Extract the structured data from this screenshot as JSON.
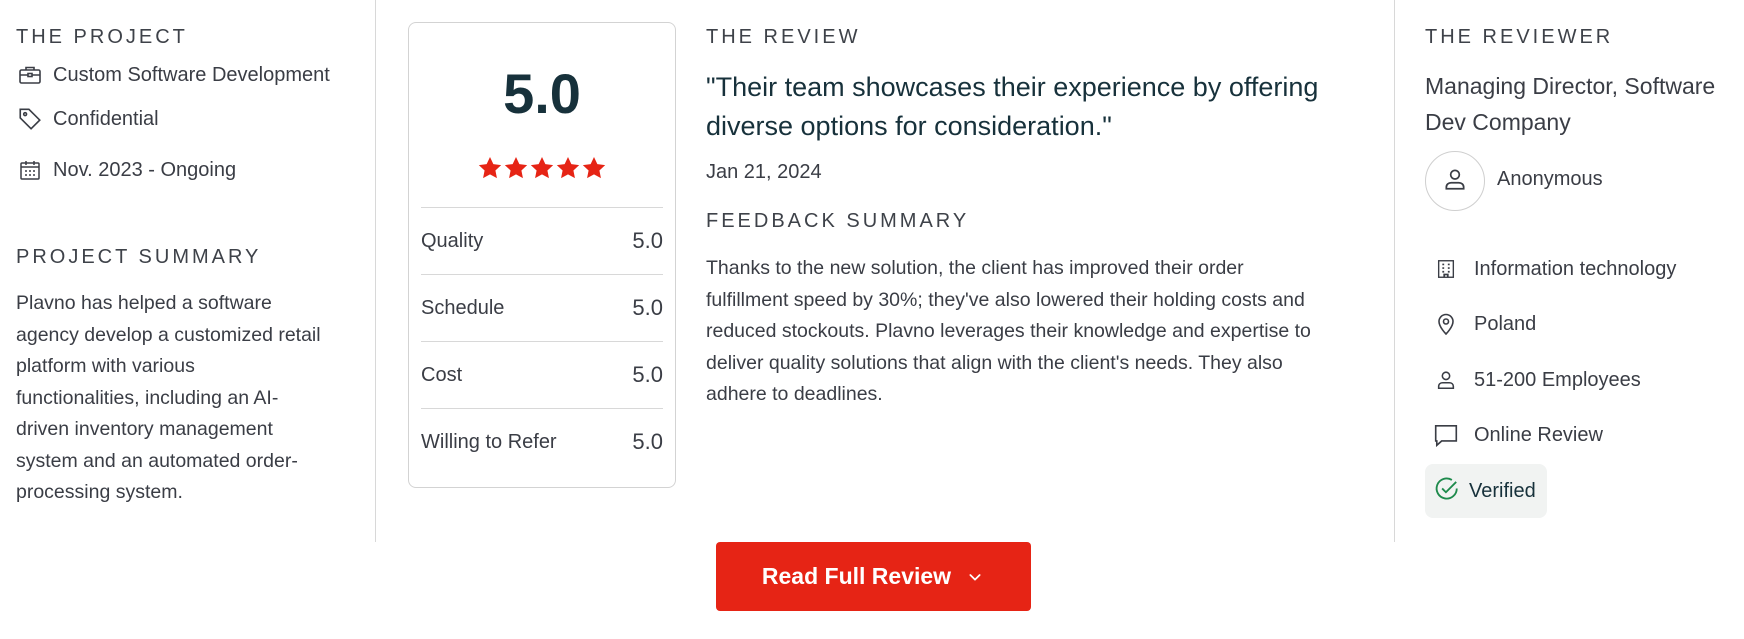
{
  "project": {
    "heading": "THE PROJECT",
    "service": "Custom Software Development",
    "budget": "Confidential",
    "dates": "Nov. 2023 - Ongoing",
    "summary_heading": "PROJECT SUMMARY",
    "summary_lines": [
      "Plavno has helped a software",
      "agency develop a customized retail",
      "platform with various",
      "functionalities, including an AI-",
      "driven inventory management",
      "system and an automated order-",
      "processing system."
    ]
  },
  "rating": {
    "overall": "5.0",
    "star_count": 5,
    "star_color": "#e62415",
    "rows": [
      {
        "label": "Quality",
        "value": "5.0"
      },
      {
        "label": "Schedule",
        "value": "5.0"
      },
      {
        "label": "Cost",
        "value": "5.0"
      },
      {
        "label": "Willing to Refer",
        "value": "5.0"
      }
    ]
  },
  "review": {
    "heading": "THE REVIEW",
    "quote_lines": [
      "\"Their team showcases their experience by offering",
      "diverse options for consideration.\""
    ],
    "date": "Jan 21, 2024",
    "feedback_heading": "FEEDBACK SUMMARY",
    "feedback_lines": [
      "Thanks to the new solution, the client has improved their order",
      "fulfillment speed by 30%; they've also lowered their holding costs and",
      "reduced stockouts. Plavno leverages their knowledge and expertise to",
      "deliver quality solutions that align with the client's needs. They also",
      "adhere to deadlines."
    ]
  },
  "reviewer": {
    "heading": "THE REVIEWER",
    "title_lines": [
      "Managing Director, Software",
      "Dev Company"
    ],
    "name": "Anonymous",
    "industry": "Information technology",
    "location": "Poland",
    "company_size": "51-200 Employees",
    "review_type": "Online Review",
    "verified": "Verified",
    "verified_color": "#1e8a4c"
  },
  "cta": {
    "label": "Read Full Review",
    "color": "#e62415"
  },
  "icons": {
    "service": "briefcase-icon",
    "budget": "tag-icon",
    "dates": "calendar-icon",
    "avatar": "user-icon",
    "industry": "building-icon",
    "location": "map-pin-icon",
    "company_size": "person-icon",
    "review_type": "chat-bubble-icon",
    "verified": "check-circle-icon",
    "chevron": "chevron-down-icon"
  }
}
